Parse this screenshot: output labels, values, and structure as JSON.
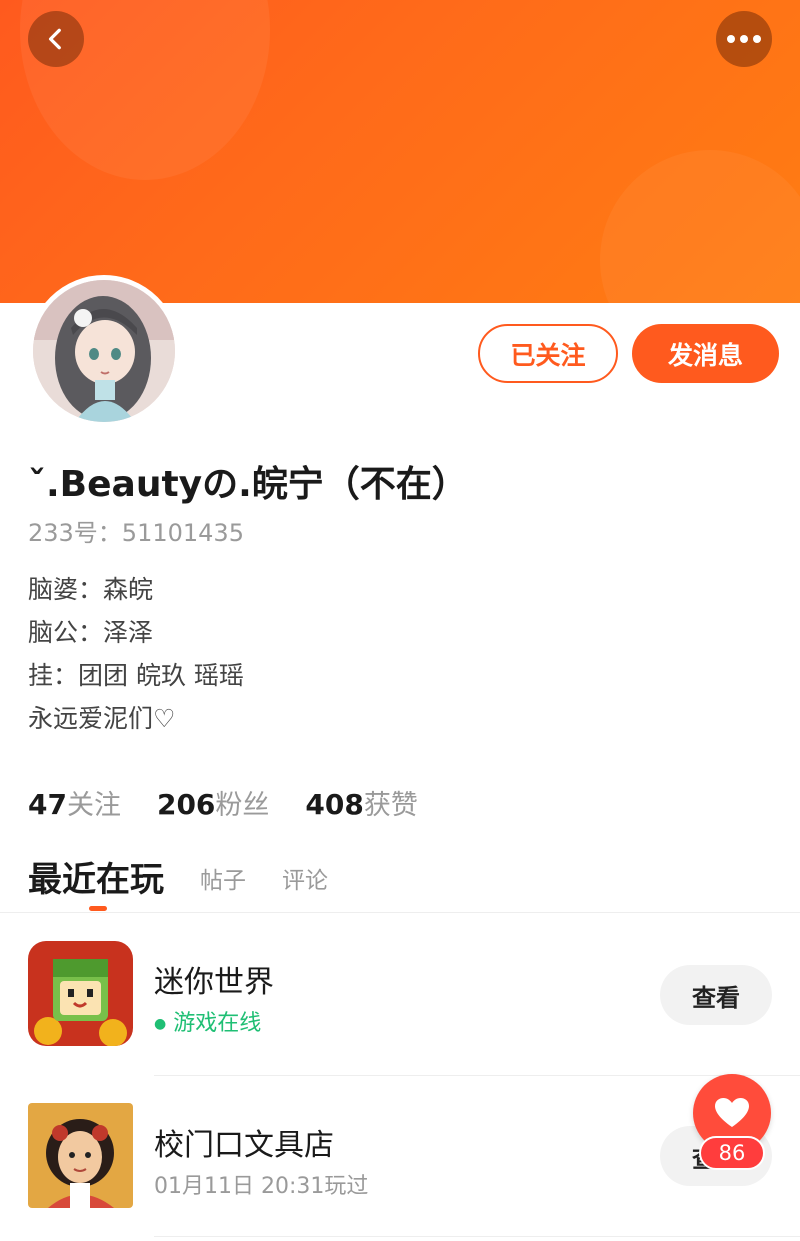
{
  "header": {
    "back_icon": "chevron-left-icon",
    "more_icon": "more-dots-icon",
    "banner_color": "#ff6a1a"
  },
  "profile": {
    "username": "ˇ.Beautyの.皖宁（不在）",
    "id_text": "233号：51101435",
    "follow_button": "已关注",
    "message_button": "发消息",
    "bio": [
      "脑婆：森皖",
      "脑公：泽泽",
      "挂：团团 皖玖 瑶瑶",
      "永远爱泥们♡"
    ]
  },
  "stats": [
    {
      "value": "47",
      "label": "关注"
    },
    {
      "value": "206",
      "label": "粉丝"
    },
    {
      "value": "408",
      "label": "获赞"
    }
  ],
  "tabs": [
    {
      "label": "最近在玩",
      "active": true
    },
    {
      "label": "帖子",
      "active": false
    },
    {
      "label": "评论",
      "active": false
    }
  ],
  "games": [
    {
      "title": "迷你世界",
      "status": "游戏在线",
      "button": "查看"
    },
    {
      "title": "校门口文具店",
      "status": "01月11日 20:31玩过",
      "button": "查看"
    }
  ],
  "like_fab": {
    "icon": "heart-icon",
    "count": "86"
  },
  "colors": {
    "accent": "#ff5a1e",
    "online": "#1fbf74",
    "like": "#ff4c3b"
  }
}
